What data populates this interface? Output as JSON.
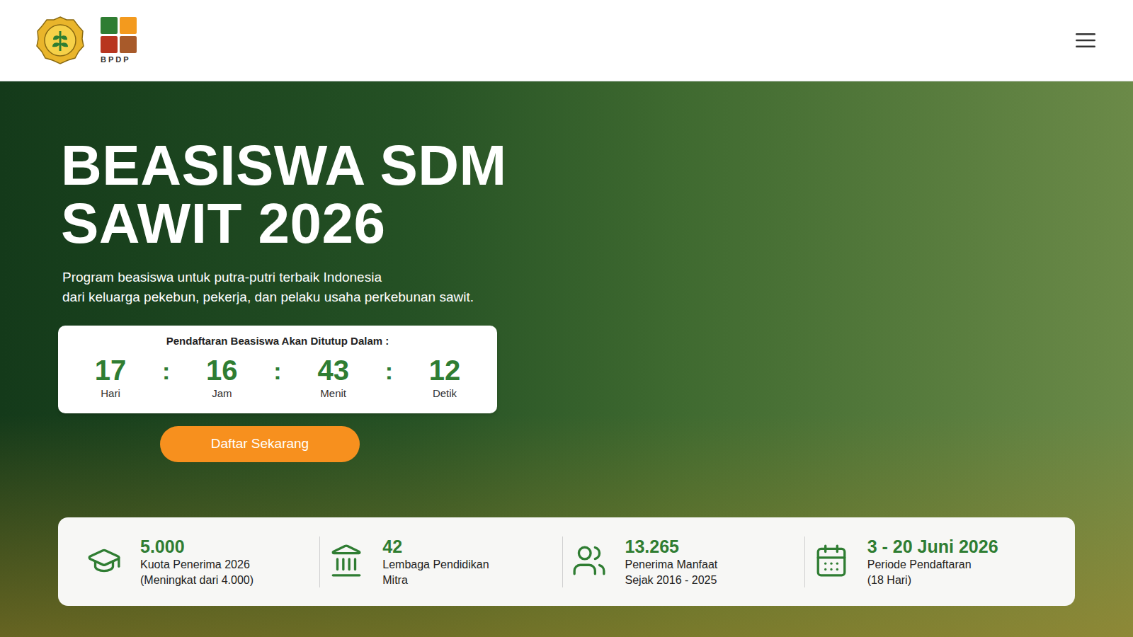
{
  "header": {
    "logo_text": "BPDP"
  },
  "hero": {
    "title_lines": [
      "BEASISWA SDM",
      "SAWIT 2026"
    ],
    "subtitle_lines": [
      "Program beasiswa untuk putra-putri terbaik Indonesia",
      "dari keluarga pekebun, pekerja, dan pelaku usaha perkebunan sawit."
    ]
  },
  "countdown": {
    "label": "Pendaftaran Beasiswa Akan Ditutup Dalam :",
    "separator": ":",
    "units": [
      {
        "value": "17",
        "label": "Hari"
      },
      {
        "value": "16",
        "label": "Jam"
      },
      {
        "value": "43",
        "label": "Menit"
      },
      {
        "value": "12",
        "label": "Detik"
      }
    ]
  },
  "cta": {
    "label": "Daftar Sekarang"
  },
  "stats": [
    {
      "value": "5.000",
      "label_lines": [
        "Kuota Penerima 2026",
        "(Meningkat dari 4.000)"
      ]
    },
    {
      "value": "42",
      "label_lines": [
        "Lembaga Pendidikan",
        "Mitra"
      ]
    },
    {
      "value": "13.265",
      "label_lines": [
        "Penerima Manfaat",
        "Sejak 2016 - 2025"
      ]
    },
    {
      "value": "3 - 20 Juni 2026",
      "label_lines": [
        "Periode Pendaftaran",
        "(18 Hari)"
      ]
    }
  ]
}
